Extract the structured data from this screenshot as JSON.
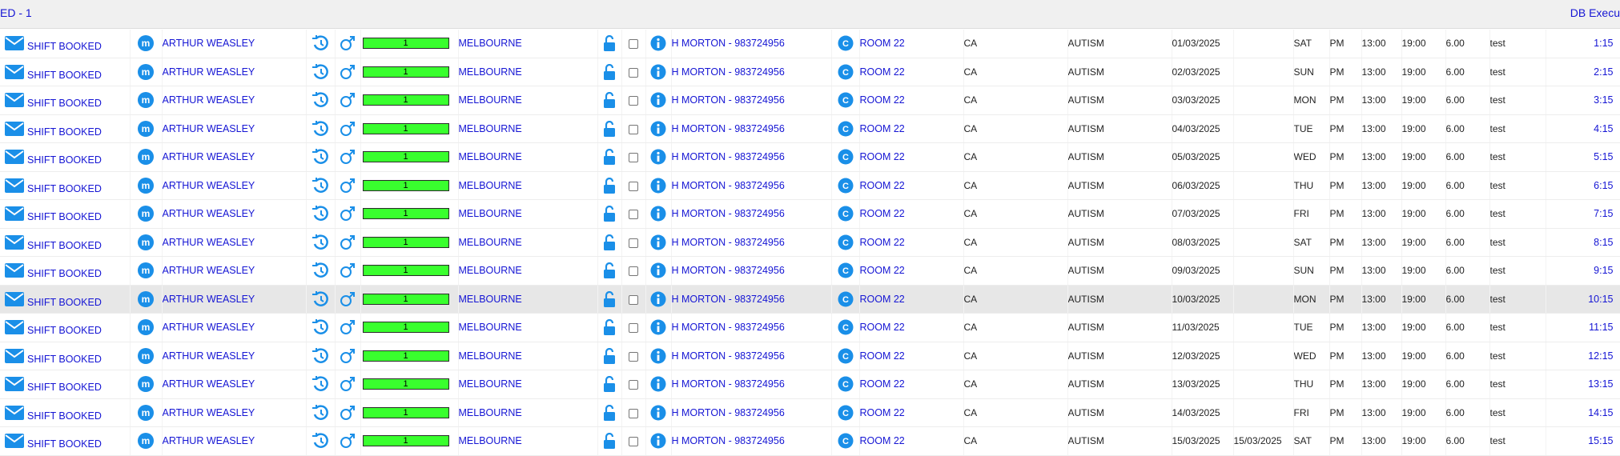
{
  "header": {
    "left": "ED - 1",
    "right": "DB Execu"
  },
  "colors": {
    "link": "#1515d4",
    "icon_blue": "#1a8fe8",
    "bar_green": "#39ff2e",
    "highlight_row": "#e7e7e7"
  },
  "icons": {
    "status": "envelope-icon",
    "chat": "messenger-icon",
    "history": "history-icon",
    "gender": "male-icon",
    "lock": "unlock-icon",
    "info": "info-icon",
    "client": "c-badge-icon"
  },
  "rows": [
    {
      "status": "SHIFT BOOKED",
      "worker": "ARTHUR WEASLEY",
      "bar": "1",
      "location": "MELBOURNE",
      "contact": "H MORTON - 983724956",
      "room": "ROOM 22",
      "state": "CA",
      "program": "AUTISM",
      "date": "01/03/2025",
      "date2": "",
      "day": "SAT",
      "period": "PM",
      "start": "13:00",
      "end": "19:00",
      "hours": "6.00",
      "note": "test",
      "time": "1:15"
    },
    {
      "status": "SHIFT BOOKED",
      "worker": "ARTHUR WEASLEY",
      "bar": "1",
      "location": "MELBOURNE",
      "contact": "H MORTON - 983724956",
      "room": "ROOM 22",
      "state": "CA",
      "program": "AUTISM",
      "date": "02/03/2025",
      "date2": "",
      "day": "SUN",
      "period": "PM",
      "start": "13:00",
      "end": "19:00",
      "hours": "6.00",
      "note": "test",
      "time": "2:15"
    },
    {
      "status": "SHIFT BOOKED",
      "worker": "ARTHUR WEASLEY",
      "bar": "1",
      "location": "MELBOURNE",
      "contact": "H MORTON - 983724956",
      "room": "ROOM 22",
      "state": "CA",
      "program": "AUTISM",
      "date": "03/03/2025",
      "date2": "",
      "day": "MON",
      "period": "PM",
      "start": "13:00",
      "end": "19:00",
      "hours": "6.00",
      "note": "test",
      "time": "3:15"
    },
    {
      "status": "SHIFT BOOKED",
      "worker": "ARTHUR WEASLEY",
      "bar": "1",
      "location": "MELBOURNE",
      "contact": "H MORTON - 983724956",
      "room": "ROOM 22",
      "state": "CA",
      "program": "AUTISM",
      "date": "04/03/2025",
      "date2": "",
      "day": "TUE",
      "period": "PM",
      "start": "13:00",
      "end": "19:00",
      "hours": "6.00",
      "note": "test",
      "time": "4:15"
    },
    {
      "status": "SHIFT BOOKED",
      "worker": "ARTHUR WEASLEY",
      "bar": "1",
      "location": "MELBOURNE",
      "contact": "H MORTON - 983724956",
      "room": "ROOM 22",
      "state": "CA",
      "program": "AUTISM",
      "date": "05/03/2025",
      "date2": "",
      "day": "WED",
      "period": "PM",
      "start": "13:00",
      "end": "19:00",
      "hours": "6.00",
      "note": "test",
      "time": "5:15"
    },
    {
      "status": "SHIFT BOOKED",
      "worker": "ARTHUR WEASLEY",
      "bar": "1",
      "location": "MELBOURNE",
      "contact": "H MORTON - 983724956",
      "room": "ROOM 22",
      "state": "CA",
      "program": "AUTISM",
      "date": "06/03/2025",
      "date2": "",
      "day": "THU",
      "period": "PM",
      "start": "13:00",
      "end": "19:00",
      "hours": "6.00",
      "note": "test",
      "time": "6:15"
    },
    {
      "status": "SHIFT BOOKED",
      "worker": "ARTHUR WEASLEY",
      "bar": "1",
      "location": "MELBOURNE",
      "contact": "H MORTON - 983724956",
      "room": "ROOM 22",
      "state": "CA",
      "program": "AUTISM",
      "date": "07/03/2025",
      "date2": "",
      "day": "FRI",
      "period": "PM",
      "start": "13:00",
      "end": "19:00",
      "hours": "6.00",
      "note": "test",
      "time": "7:15"
    },
    {
      "status": "SHIFT BOOKED",
      "worker": "ARTHUR WEASLEY",
      "bar": "1",
      "location": "MELBOURNE",
      "contact": "H MORTON - 983724956",
      "room": "ROOM 22",
      "state": "CA",
      "program": "AUTISM",
      "date": "08/03/2025",
      "date2": "",
      "day": "SAT",
      "period": "PM",
      "start": "13:00",
      "end": "19:00",
      "hours": "6.00",
      "note": "test",
      "time": "8:15"
    },
    {
      "status": "SHIFT BOOKED",
      "worker": "ARTHUR WEASLEY",
      "bar": "1",
      "location": "MELBOURNE",
      "contact": "H MORTON - 983724956",
      "room": "ROOM 22",
      "state": "CA",
      "program": "AUTISM",
      "date": "09/03/2025",
      "date2": "",
      "day": "SUN",
      "period": "PM",
      "start": "13:00",
      "end": "19:00",
      "hours": "6.00",
      "note": "test",
      "time": "9:15"
    },
    {
      "status": "SHIFT BOOKED",
      "worker": "ARTHUR WEASLEY",
      "bar": "1",
      "location": "MELBOURNE",
      "contact": "H MORTON - 983724956",
      "room": "ROOM 22",
      "state": "CA",
      "program": "AUTISM",
      "date": "10/03/2025",
      "date2": "",
      "day": "MON",
      "period": "PM",
      "start": "13:00",
      "end": "19:00",
      "hours": "6.00",
      "note": "test",
      "time": "10:15",
      "highlight": true
    },
    {
      "status": "SHIFT BOOKED",
      "worker": "ARTHUR WEASLEY",
      "bar": "1",
      "location": "MELBOURNE",
      "contact": "H MORTON - 983724956",
      "room": "ROOM 22",
      "state": "CA",
      "program": "AUTISM",
      "date": "11/03/2025",
      "date2": "",
      "day": "TUE",
      "period": "PM",
      "start": "13:00",
      "end": "19:00",
      "hours": "6.00",
      "note": "test",
      "time": "11:15"
    },
    {
      "status": "SHIFT BOOKED",
      "worker": "ARTHUR WEASLEY",
      "bar": "1",
      "location": "MELBOURNE",
      "contact": "H MORTON - 983724956",
      "room": "ROOM 22",
      "state": "CA",
      "program": "AUTISM",
      "date": "12/03/2025",
      "date2": "",
      "day": "WED",
      "period": "PM",
      "start": "13:00",
      "end": "19:00",
      "hours": "6.00",
      "note": "test",
      "time": "12:15"
    },
    {
      "status": "SHIFT BOOKED",
      "worker": "ARTHUR WEASLEY",
      "bar": "1",
      "location": "MELBOURNE",
      "contact": "H MORTON - 983724956",
      "room": "ROOM 22",
      "state": "CA",
      "program": "AUTISM",
      "date": "13/03/2025",
      "date2": "",
      "day": "THU",
      "period": "PM",
      "start": "13:00",
      "end": "19:00",
      "hours": "6.00",
      "note": "test",
      "time": "13:15"
    },
    {
      "status": "SHIFT BOOKED",
      "worker": "ARTHUR WEASLEY",
      "bar": "1",
      "location": "MELBOURNE",
      "contact": "H MORTON - 983724956",
      "room": "ROOM 22",
      "state": "CA",
      "program": "AUTISM",
      "date": "14/03/2025",
      "date2": "",
      "day": "FRI",
      "period": "PM",
      "start": "13:00",
      "end": "19:00",
      "hours": "6.00",
      "note": "test",
      "time": "14:15"
    },
    {
      "status": "SHIFT BOOKED",
      "worker": "ARTHUR WEASLEY",
      "bar": "1",
      "location": "MELBOURNE",
      "contact": "H MORTON - 983724956",
      "room": "ROOM 22",
      "state": "CA",
      "program": "AUTISM",
      "date": "15/03/2025",
      "date2": "15/03/2025",
      "day": "SAT",
      "period": "PM",
      "start": "13:00",
      "end": "19:00",
      "hours": "6.00",
      "note": "test",
      "time": "15:15"
    }
  ]
}
